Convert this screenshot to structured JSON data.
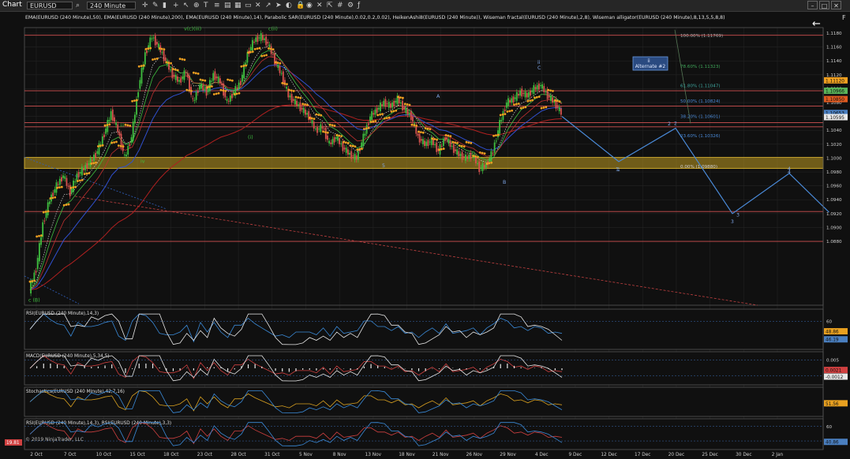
{
  "toolbar": {
    "title": "Chart",
    "instrument": "EURUSD",
    "interval": "240 Minute",
    "buttons": [
      "search-icon",
      "crosshair-icon",
      "draw-icon",
      "bars-icon",
      "plus-icon",
      "cursor-icon",
      "zoom-icon",
      "text-icon",
      "list-icon",
      "properties-icon",
      "layout-icon",
      "rect-icon",
      "close-icon",
      "arrow-icon",
      "pointer-icon",
      "toggle-icon",
      "lock-icon",
      "eye-icon",
      "cross-icon",
      "cursor-alt-icon",
      "grid-icon",
      "settings-icon",
      "f-icon"
    ],
    "window_buttons": [
      "minimize-icon",
      "maximize-icon",
      "close-icon"
    ],
    "corner_label": "F"
  },
  "legend_text": "EMA(EURUSD (240 Minute),50), EMA(EURUSD (240 Minute),200), EMA(EURUSD (240 Minute),14), Parabolic SAR(EURUSD (240 Minute),0.02,0.2,0.02), HeikenAshi8(EURUSD (240 Minute)), Wiseman fractal(EURUSD (240 Minute),2,8), Wiseman alligator(EURUSD (240 Minute),8,13,5,5,8,8)",
  "copyright": "© 2019 NinjaTrader, LLC",
  "colors": {
    "background": "#101010",
    "grid": "#232323",
    "up_candle": "#3fbf3f",
    "down_candle": "#d9534f",
    "sar": "#f0a020",
    "ema50": "#3050d0",
    "ema200": "#c02020",
    "level_line": "#d05050",
    "projection": "#4a8ad8",
    "zone": "#c09a20"
  },
  "chart_data": {
    "type": "line",
    "title": "",
    "instrument": "EURUSD",
    "interval": "240 Minute",
    "price_axis": {
      "ylim": [
        1.0788,
        1.1188
      ],
      "ticks": [
        "1.1180",
        "1.1160",
        "1.1140",
        "1.1120",
        "1.1100",
        "1.1080",
        "1.1060",
        "1.1040",
        "1.1020",
        "1.1000",
        "1.0980",
        "1.0960",
        "1.0940",
        "1.0920",
        "1.0900",
        "1.0880"
      ]
    },
    "x_labels": [
      "2 Oct",
      "7 Oct",
      "10 Oct",
      "15 Oct",
      "18 Oct",
      "23 Oct",
      "28 Oct",
      "31 Oct",
      "5 Nov",
      "8 Nov",
      "13 Nov",
      "18 Nov",
      "21 Nov",
      "26 Nov",
      "29 Nov",
      "4 Dec",
      "9 Dec",
      "12 Dec",
      "17 Dec",
      "20 Dec",
      "25 Dec",
      "30 Dec",
      "2 Jan"
    ],
    "price_markers": [
      {
        "label": "1.11120",
        "value": 1.1112,
        "color": "#f0a020"
      },
      {
        "label": "1.10966",
        "value": 1.1097,
        "color": "#5ab55a"
      },
      {
        "label": "1.10850",
        "value": 1.1085,
        "color": "#e05a20"
      },
      {
        "label": "1.10653",
        "value": 1.1065,
        "color": "#4a7fc0"
      },
      {
        "label": "1.10595",
        "value": 1.1059,
        "color": "#e8e8e8"
      }
    ],
    "horizontal_levels": [
      1.1177,
      1.1097,
      1.1075,
      1.1051,
      1.1045,
      1.0923,
      1.088
    ],
    "zone": [
      1.0985,
      1.1001
    ],
    "fibonacci": [
      {
        "label": "100.00% (1.11769)",
        "value": 1.11769
      },
      {
        "label": "78.60% (1.11323)",
        "value": 1.11323
      },
      {
        "label": "61.80% (1.11047)",
        "value": 1.11047
      },
      {
        "label": "50.00% (1.10824)",
        "value": 1.10824
      },
      {
        "label": "38.20% (1.10601)",
        "value": 1.10601
      },
      {
        "label": "23.60% (1.10326)",
        "value": 1.10326
      },
      {
        "label": "0.00% (1.09880)",
        "value": 1.0988
      }
    ],
    "price_path": [
      1.081,
      1.084,
      1.0905,
      1.094,
      1.096,
      1.0975,
      1.095,
      1.0975,
      1.0985,
      1.0995,
      1.101,
      1.1035,
      1.1065,
      1.104,
      1.1,
      1.103,
      1.11,
      1.115,
      1.1175,
      1.116,
      1.114,
      1.112,
      1.111,
      1.1125,
      1.108,
      1.1105,
      1.1095,
      1.112,
      1.111,
      1.108,
      1.1095,
      1.111,
      1.115,
      1.117,
      1.1175,
      1.1165,
      1.114,
      1.112,
      1.109,
      1.108,
      1.107,
      1.106,
      1.104,
      1.1045,
      1.102,
      1.103,
      1.1015,
      1.1005,
      1.1,
      1.103,
      1.106,
      1.107,
      1.108,
      1.1075,
      1.1085,
      1.107,
      1.106,
      1.103,
      1.102,
      1.1025,
      1.101,
      1.103,
      1.1015,
      1.1005,
      1.1,
      1.1005,
      1.0985,
      1.099,
      1.101,
      1.105,
      1.108,
      1.1085,
      1.1095,
      1.109,
      1.11,
      1.1105,
      1.109,
      1.108,
      1.1065
    ],
    "projection_path": [
      [
        1.106,
        0
      ],
      [
        1.0995,
        1
      ],
      [
        1.1043,
        2
      ],
      [
        1.092,
        3
      ],
      [
        1.0978,
        4
      ],
      [
        1.0922,
        4.7
      ]
    ],
    "wave_labels": [
      {
        "text": "c (B)",
        "color": "#3fbf3f"
      },
      {
        "text": "v(c)(iii)",
        "color": "#3fbf3f"
      },
      {
        "text": "c(ii)",
        "color": "#3fbf3f"
      },
      {
        "text": "(i)",
        "color": "#3fbf3f"
      },
      {
        "text": "iii",
        "color": "#3fbf3f"
      },
      {
        "text": "iv",
        "color": "#3fbf3f"
      },
      {
        "text": "A",
        "color": "#7fa7e8"
      },
      {
        "text": "B",
        "color": "#7fa7e8"
      },
      {
        "text": "C",
        "color": "#7fa7e8"
      },
      {
        "text": "ii",
        "color": "#7fa7e8"
      },
      {
        "text": "1",
        "color": "#7fa7e8"
      },
      {
        "text": "2",
        "color": "#7fa7e8"
      },
      {
        "text": "3",
        "color": "#7fa7e8"
      },
      {
        "text": "4",
        "color": "#7fa7e8"
      },
      {
        "text": "5",
        "color": "#7fa7e8"
      }
    ],
    "alternate_box": {
      "line1": "ii",
      "line2": "Alternate #2"
    },
    "panels": [
      {
        "name": "RSI(EURUSD (240 Minute),14,3)",
        "ticks": [
          "60"
        ],
        "markers": [
          {
            "label": "48.86",
            "color": "#e8a020"
          },
          {
            "label": "46.19",
            "color": "#4a7fc0"
          }
        ]
      },
      {
        "name": "MACD(EURUSD (240 Minute),5,34,5)",
        "ticks": [
          "0.005",
          "0"
        ],
        "markers": [
          {
            "label": "0.0021",
            "color": "#d04040"
          },
          {
            "label": "-0.0012",
            "color": "#e8e8e8"
          }
        ]
      },
      {
        "name": "Stochastics(EURUSD (240 Minute),42,7,16)",
        "ticks": [],
        "markers": [
          {
            "label": "51.56",
            "color": "#e8a020"
          }
        ]
      },
      {
        "name": "RSI(EURUSD (240 Minute),14,3), RSI(EURUSD (240 Minute),3,3)",
        "ticks": [
          "60",
          "40"
        ],
        "markers": [
          {
            "label": "19.81",
            "color": "#d04040"
          },
          {
            "label": "40.86",
            "color": "#4a7fc0"
          }
        ]
      }
    ]
  }
}
